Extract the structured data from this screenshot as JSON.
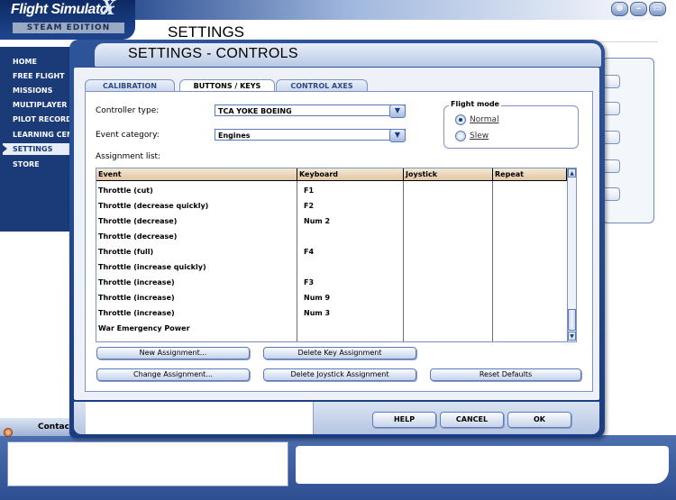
{
  "app": {
    "logo_title": "Flight Simulator",
    "logo_x": "X",
    "logo_sub": "STEAM EDITION",
    "window_buttons": [
      "⊗",
      "–",
      "▭"
    ],
    "background_heading": "SETTINGS"
  },
  "sidebar": {
    "items": [
      {
        "label": "HOME"
      },
      {
        "label": "FREE FLIGHT"
      },
      {
        "label": "MISSIONS"
      },
      {
        "label": "MULTIPLAYER"
      },
      {
        "label": "PILOT RECORDS"
      },
      {
        "label": "LEARNING CENTER"
      },
      {
        "label": "SETTINGS",
        "active": true
      },
      {
        "label": "STORE"
      }
    ]
  },
  "contacts": {
    "label": "Contacts"
  },
  "dialog": {
    "title": "SETTINGS - CONTROLS",
    "tabs": [
      {
        "label": "CALIBRATION"
      },
      {
        "label": "BUTTONS / KEYS",
        "active": true
      },
      {
        "label": "CONTROL AXES"
      }
    ],
    "controller_type": {
      "label": "Controller type:",
      "value": "TCA YOKE BOEING"
    },
    "event_category": {
      "label": "Event category:",
      "value": "Engines"
    },
    "assignment_list_label": "Assignment list:",
    "flight_mode": {
      "title": "Flight mode",
      "options": [
        {
          "label": "Normal",
          "selected": true
        },
        {
          "label": "Slew",
          "selected": false
        }
      ]
    },
    "table": {
      "columns": [
        "Event",
        "Keyboard",
        "Joystick",
        "Repeat"
      ],
      "rows": [
        {
          "event": "Throttle (cut)",
          "keyboard": "F1",
          "joystick": "",
          "repeat": ""
        },
        {
          "event": "Throttle (decrease quickly)",
          "keyboard": "F2",
          "joystick": "",
          "repeat": ""
        },
        {
          "event": "Throttle (decrease)",
          "keyboard": "Num 2",
          "joystick": "",
          "repeat": ""
        },
        {
          "event": "Throttle (decrease)",
          "keyboard": "",
          "joystick": "",
          "repeat": ""
        },
        {
          "event": "Throttle (full)",
          "keyboard": "F4",
          "joystick": "",
          "repeat": ""
        },
        {
          "event": "Throttle (increase quickly)",
          "keyboard": "",
          "joystick": "",
          "repeat": ""
        },
        {
          "event": "Throttle (increase)",
          "keyboard": "F3",
          "joystick": "",
          "repeat": ""
        },
        {
          "event": "Throttle (increase)",
          "keyboard": "Num 9",
          "joystick": "",
          "repeat": ""
        },
        {
          "event": "Throttle (increase)",
          "keyboard": "Num 3",
          "joystick": "",
          "repeat": ""
        },
        {
          "event": "War Emergency Power",
          "keyboard": "",
          "joystick": "",
          "repeat": ""
        }
      ]
    },
    "buttons": {
      "new_assignment": "New Assignment...",
      "delete_key_assignment": "Delete Key Assignment",
      "change_assignment": "Change Assignment...",
      "delete_joystick_assignment": "Delete Joystick Assignment",
      "reset_defaults": "Reset Defaults",
      "help": "HELP",
      "cancel": "CANCEL",
      "ok": "OK"
    }
  }
}
